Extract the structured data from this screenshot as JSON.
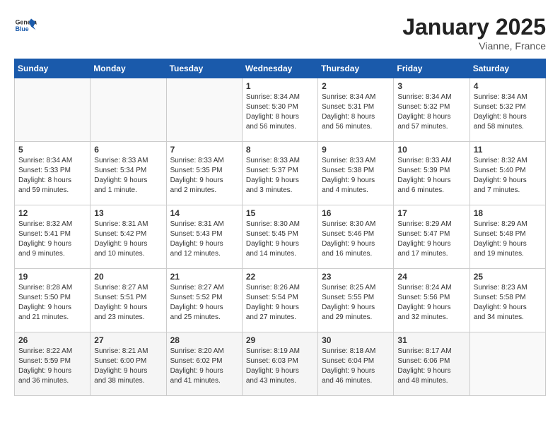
{
  "header": {
    "logo": {
      "general": "General",
      "blue": "Blue"
    },
    "title": "January 2025",
    "location": "Vianne, France"
  },
  "calendar": {
    "weekdays": [
      "Sunday",
      "Monday",
      "Tuesday",
      "Wednesday",
      "Thursday",
      "Friday",
      "Saturday"
    ],
    "weeks": [
      [
        {
          "day": "",
          "content": ""
        },
        {
          "day": "",
          "content": ""
        },
        {
          "day": "",
          "content": ""
        },
        {
          "day": "1",
          "content": "Sunrise: 8:34 AM\nSunset: 5:30 PM\nDaylight: 8 hours\nand 56 minutes."
        },
        {
          "day": "2",
          "content": "Sunrise: 8:34 AM\nSunset: 5:31 PM\nDaylight: 8 hours\nand 56 minutes."
        },
        {
          "day": "3",
          "content": "Sunrise: 8:34 AM\nSunset: 5:32 PM\nDaylight: 8 hours\nand 57 minutes."
        },
        {
          "day": "4",
          "content": "Sunrise: 8:34 AM\nSunset: 5:32 PM\nDaylight: 8 hours\nand 58 minutes."
        }
      ],
      [
        {
          "day": "5",
          "content": "Sunrise: 8:34 AM\nSunset: 5:33 PM\nDaylight: 8 hours\nand 59 minutes."
        },
        {
          "day": "6",
          "content": "Sunrise: 8:33 AM\nSunset: 5:34 PM\nDaylight: 9 hours\nand 1 minute."
        },
        {
          "day": "7",
          "content": "Sunrise: 8:33 AM\nSunset: 5:35 PM\nDaylight: 9 hours\nand 2 minutes."
        },
        {
          "day": "8",
          "content": "Sunrise: 8:33 AM\nSunset: 5:37 PM\nDaylight: 9 hours\nand 3 minutes."
        },
        {
          "day": "9",
          "content": "Sunrise: 8:33 AM\nSunset: 5:38 PM\nDaylight: 9 hours\nand 4 minutes."
        },
        {
          "day": "10",
          "content": "Sunrise: 8:33 AM\nSunset: 5:39 PM\nDaylight: 9 hours\nand 6 minutes."
        },
        {
          "day": "11",
          "content": "Sunrise: 8:32 AM\nSunset: 5:40 PM\nDaylight: 9 hours\nand 7 minutes."
        }
      ],
      [
        {
          "day": "12",
          "content": "Sunrise: 8:32 AM\nSunset: 5:41 PM\nDaylight: 9 hours\nand 9 minutes."
        },
        {
          "day": "13",
          "content": "Sunrise: 8:31 AM\nSunset: 5:42 PM\nDaylight: 9 hours\nand 10 minutes."
        },
        {
          "day": "14",
          "content": "Sunrise: 8:31 AM\nSunset: 5:43 PM\nDaylight: 9 hours\nand 12 minutes."
        },
        {
          "day": "15",
          "content": "Sunrise: 8:30 AM\nSunset: 5:45 PM\nDaylight: 9 hours\nand 14 minutes."
        },
        {
          "day": "16",
          "content": "Sunrise: 8:30 AM\nSunset: 5:46 PM\nDaylight: 9 hours\nand 16 minutes."
        },
        {
          "day": "17",
          "content": "Sunrise: 8:29 AM\nSunset: 5:47 PM\nDaylight: 9 hours\nand 17 minutes."
        },
        {
          "day": "18",
          "content": "Sunrise: 8:29 AM\nSunset: 5:48 PM\nDaylight: 9 hours\nand 19 minutes."
        }
      ],
      [
        {
          "day": "19",
          "content": "Sunrise: 8:28 AM\nSunset: 5:50 PM\nDaylight: 9 hours\nand 21 minutes."
        },
        {
          "day": "20",
          "content": "Sunrise: 8:27 AM\nSunset: 5:51 PM\nDaylight: 9 hours\nand 23 minutes."
        },
        {
          "day": "21",
          "content": "Sunrise: 8:27 AM\nSunset: 5:52 PM\nDaylight: 9 hours\nand 25 minutes."
        },
        {
          "day": "22",
          "content": "Sunrise: 8:26 AM\nSunset: 5:54 PM\nDaylight: 9 hours\nand 27 minutes."
        },
        {
          "day": "23",
          "content": "Sunrise: 8:25 AM\nSunset: 5:55 PM\nDaylight: 9 hours\nand 29 minutes."
        },
        {
          "day": "24",
          "content": "Sunrise: 8:24 AM\nSunset: 5:56 PM\nDaylight: 9 hours\nand 32 minutes."
        },
        {
          "day": "25",
          "content": "Sunrise: 8:23 AM\nSunset: 5:58 PM\nDaylight: 9 hours\nand 34 minutes."
        }
      ],
      [
        {
          "day": "26",
          "content": "Sunrise: 8:22 AM\nSunset: 5:59 PM\nDaylight: 9 hours\nand 36 minutes."
        },
        {
          "day": "27",
          "content": "Sunrise: 8:21 AM\nSunset: 6:00 PM\nDaylight: 9 hours\nand 38 minutes."
        },
        {
          "day": "28",
          "content": "Sunrise: 8:20 AM\nSunset: 6:02 PM\nDaylight: 9 hours\nand 41 minutes."
        },
        {
          "day": "29",
          "content": "Sunrise: 8:19 AM\nSunset: 6:03 PM\nDaylight: 9 hours\nand 43 minutes."
        },
        {
          "day": "30",
          "content": "Sunrise: 8:18 AM\nSunset: 6:04 PM\nDaylight: 9 hours\nand 46 minutes."
        },
        {
          "day": "31",
          "content": "Sunrise: 8:17 AM\nSunset: 6:06 PM\nDaylight: 9 hours\nand 48 minutes."
        },
        {
          "day": "",
          "content": ""
        }
      ]
    ]
  }
}
